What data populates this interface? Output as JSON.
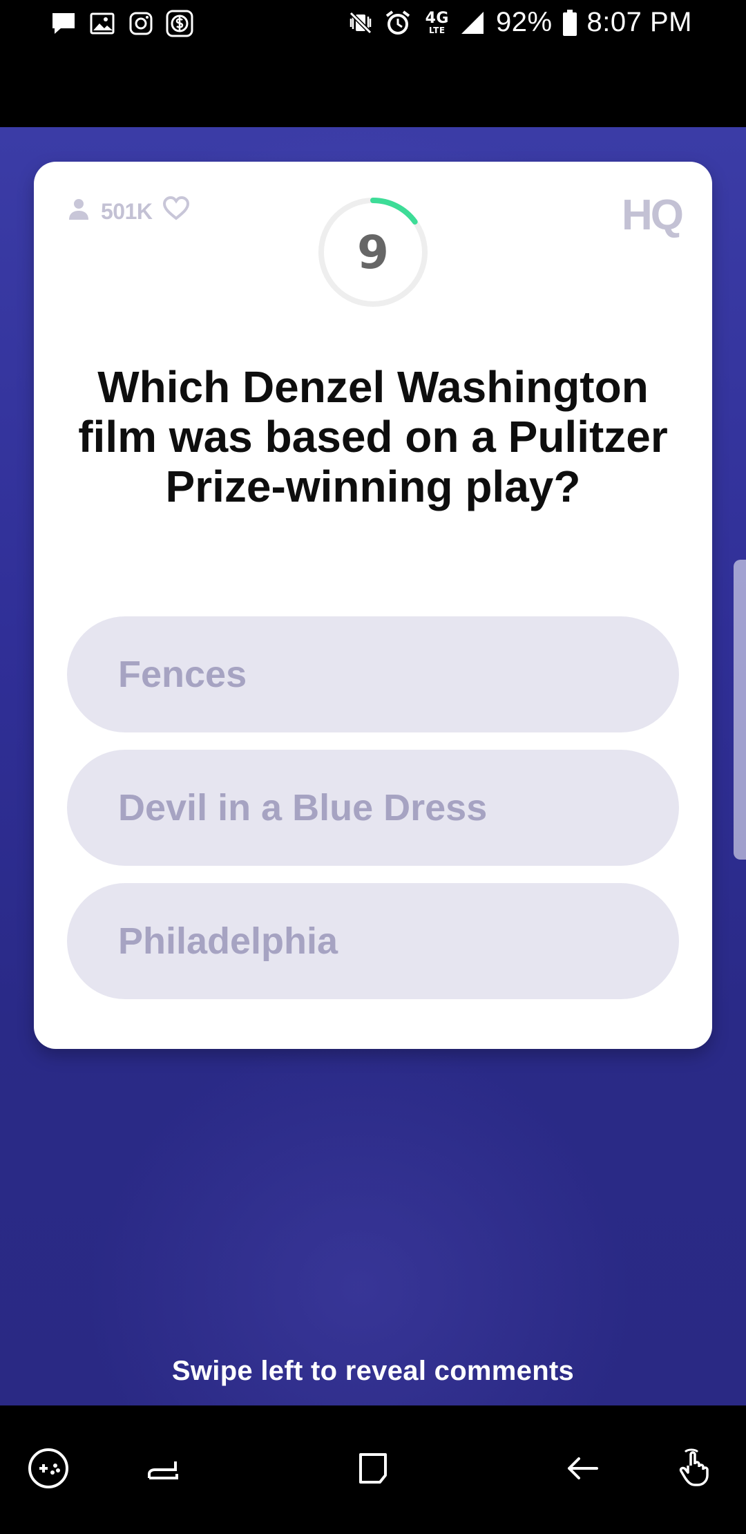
{
  "status_bar": {
    "battery_percent": "92%",
    "time": "8:07 PM",
    "network_label": "4G",
    "lte_label": "LTE",
    "icons": [
      "message-icon",
      "image-icon",
      "instagram-icon",
      "dollar-icon",
      "mute-vibrate-icon",
      "alarm-icon",
      "signal-icon",
      "battery-icon"
    ]
  },
  "game": {
    "viewer_count": "501K",
    "brand": "HQ",
    "timer_value": "9",
    "timer_progress": 0.15,
    "question": "Which Denzel Washington film was based on a Pulitzer Prize-winning play?",
    "answers": [
      {
        "label": "Fences"
      },
      {
        "label": "Devil in a Blue Dress"
      },
      {
        "label": "Philadelphia"
      }
    ],
    "hint": "Swipe left to reveal comments"
  },
  "colors": {
    "background": "#302f97",
    "answer_bg": "#e6e5f0",
    "answer_text": "#a6a3c2",
    "timer_accent": "#3ddc97"
  },
  "navigation": {
    "icons": [
      "game-controller-icon",
      "recent-apps-icon",
      "home-icon",
      "back-icon",
      "gesture-icon"
    ]
  }
}
